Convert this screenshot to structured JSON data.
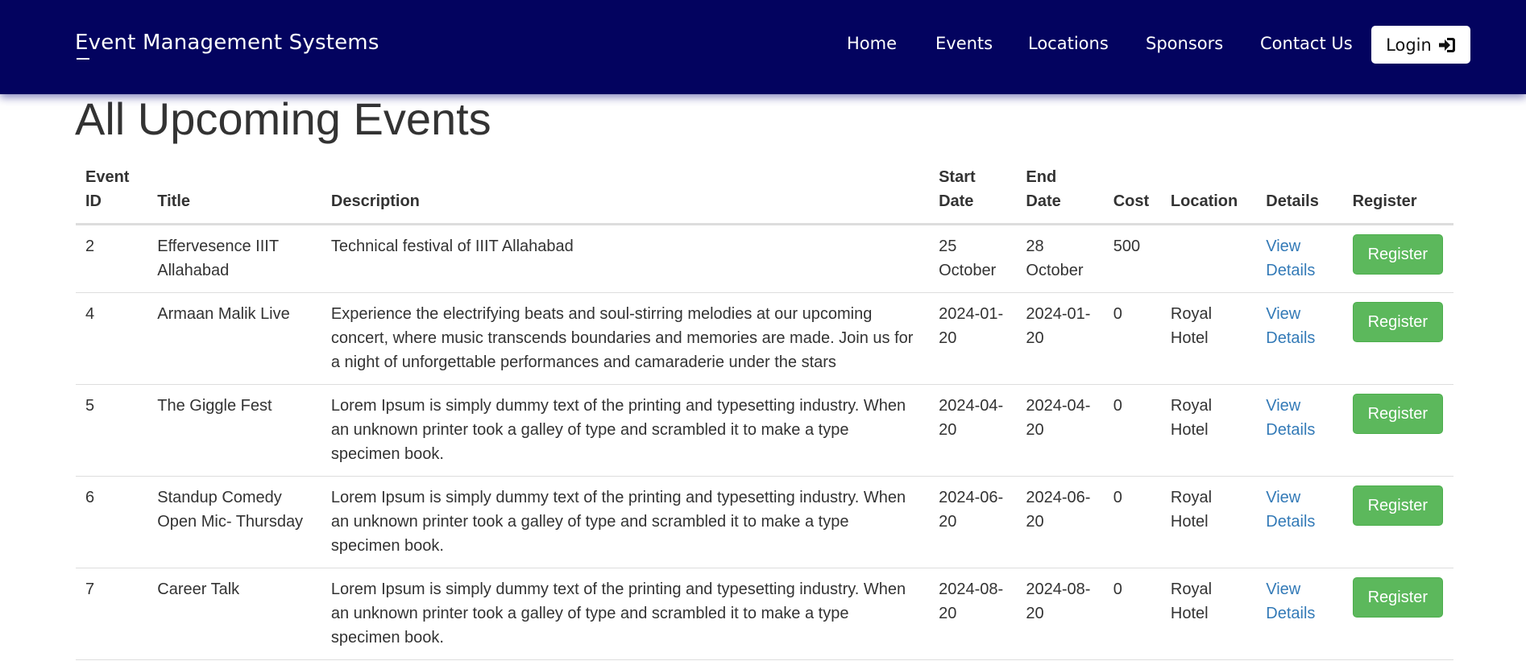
{
  "navbar": {
    "brand": "Event Management Systems",
    "links": [
      {
        "label": "Home"
      },
      {
        "label": "Events"
      },
      {
        "label": "Locations"
      },
      {
        "label": "Sponsors"
      },
      {
        "label": "Contact Us"
      }
    ],
    "login_label": "Login",
    "login_icon": "sign-in-icon",
    "background_color": "#03035f"
  },
  "page": {
    "title": "All Upcoming Events"
  },
  "table": {
    "headers": {
      "event_id": "Event ID",
      "title": "Title",
      "description": "Description",
      "start_date": "Start Date",
      "end_date": "End Date",
      "cost": "Cost",
      "location": "Location",
      "details": "Details",
      "register": "Register"
    },
    "rows": [
      {
        "id": "2",
        "title": "Effervesence IIIT Allahabad",
        "description": "Technical festival of IIIT Allahabad",
        "start": "25 October",
        "end": "28 October",
        "cost": "500",
        "location": "",
        "details": "View Details",
        "register": "Register"
      },
      {
        "id": "4",
        "title": "Armaan Malik Live",
        "description": "Experience the electrifying beats and soul-stirring melodies at our upcoming concert, where music transcends boundaries and memories are made. Join us for a night of unforgettable performances and camaraderie under the stars",
        "start": "2024-01-20",
        "end": "2024-01-20",
        "cost": "0",
        "location": "Royal Hotel",
        "details": "View Details",
        "register": "Register"
      },
      {
        "id": "5",
        "title": "The Giggle Fest",
        "description": "Lorem Ipsum is simply dummy text of the printing and typesetting industry. When an unknown printer took a galley of type and scrambled it to make a type specimen book.",
        "start": "2024-04-20",
        "end": "2024-04-20",
        "cost": "0",
        "location": "Royal Hotel",
        "details": "View Details",
        "register": "Register"
      },
      {
        "id": "6",
        "title": "Standup Comedy Open Mic- Thursday",
        "description": "Lorem Ipsum is simply dummy text of the printing and typesetting industry. When an unknown printer took a galley of type and scrambled it to make a type specimen book.",
        "start": "2024-06-20",
        "end": "2024-06-20",
        "cost": "0",
        "location": "Royal Hotel",
        "details": "View Details",
        "register": "Register"
      },
      {
        "id": "7",
        "title": "Career Talk",
        "description": "Lorem Ipsum is simply dummy text of the printing and typesetting industry. When an unknown printer took a galley of type and scrambled it to make a type specimen book.",
        "start": "2024-08-20",
        "end": "2024-08-20",
        "cost": "0",
        "location": "Royal Hotel",
        "details": "View Details",
        "register": "Register"
      }
    ]
  },
  "colors": {
    "register_button": "#5cb85c",
    "link": "#337ab7"
  }
}
